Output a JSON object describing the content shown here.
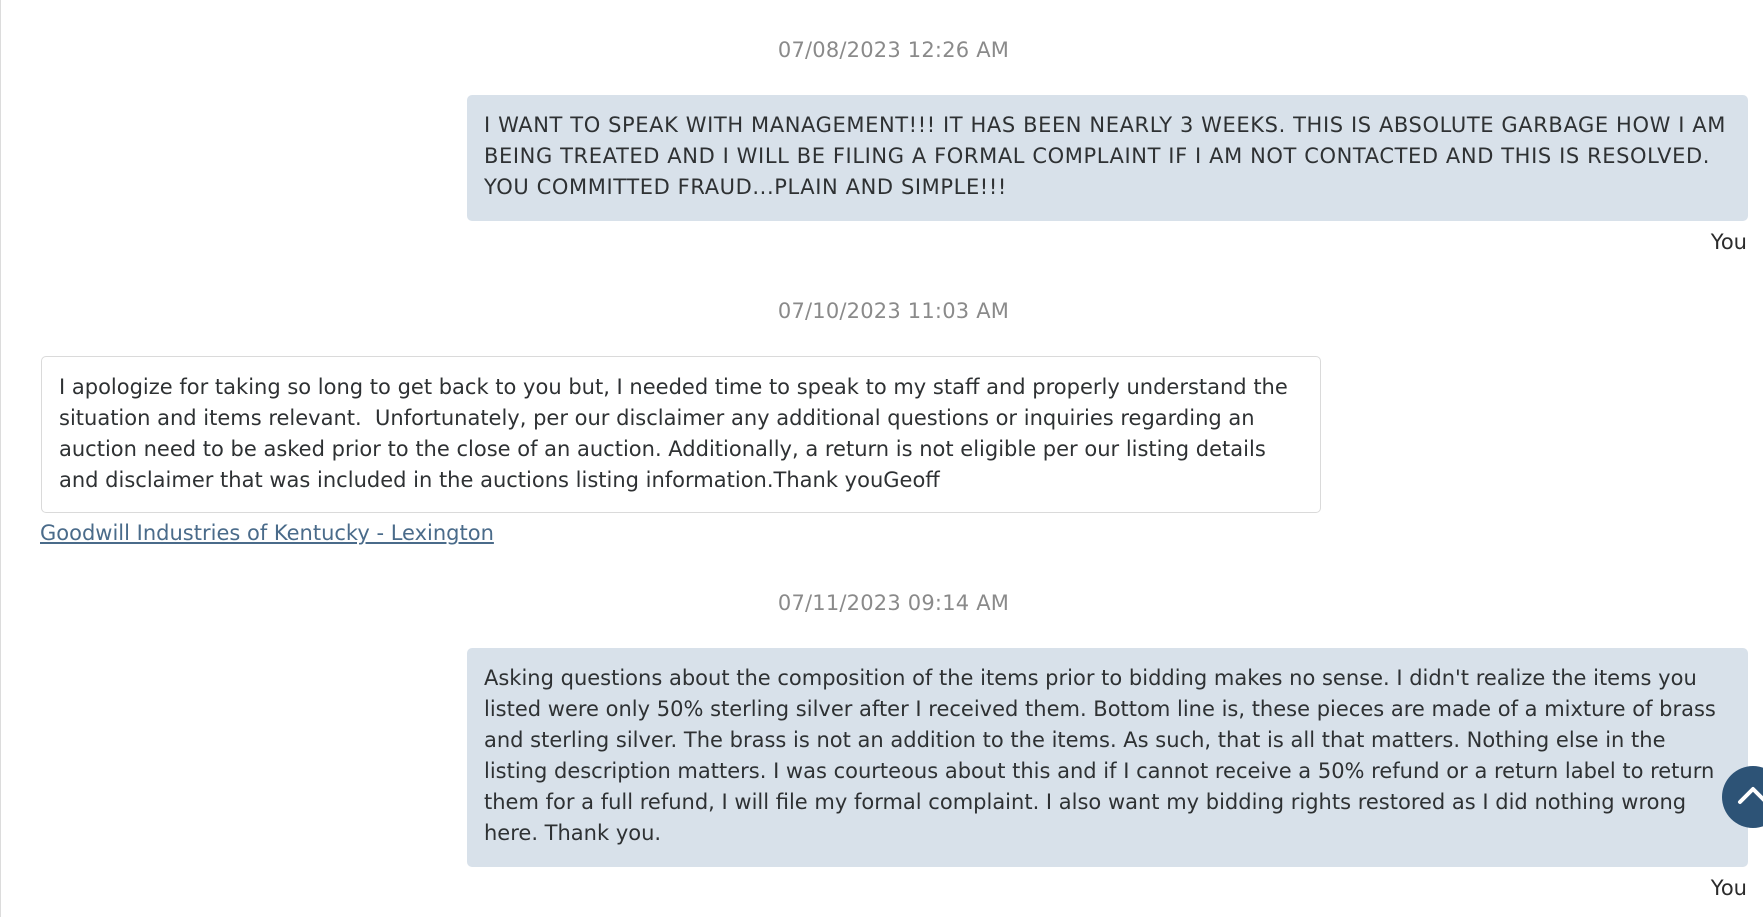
{
  "conversation": {
    "messages": [
      {
        "timestamp": "07/08/2023 12:26 AM",
        "text": "I WANT TO SPEAK WITH MANAGEMENT!!! IT HAS BEEN NEARLY 3 WEEKS. THIS IS ABSOLUTE GARBAGE HOW I AM BEING TREATED AND I WILL BE FILING A FORMAL COMPLAINT IF I AM NOT CONTACTED AND THIS IS RESOLVED. YOU COMMITTED FRAUD...PLAIN AND SIMPLE!!!",
        "sender": "You",
        "direction": "outgoing"
      },
      {
        "timestamp": "07/10/2023 11:03 AM",
        "text": "I apologize for taking so long to get back to you but, I needed time to speak to my staff and properly understand the situation and items relevant.  Unfortunately, per our disclaimer any additional questions or inquiries regarding an auction need to be asked prior to the close of an auction. Additionally, a return is not eligible per our listing details and disclaimer that was included in the auctions listing information.Thank youGeoff",
        "sender": "Goodwill Industries of Kentucky - Lexington",
        "direction": "incoming"
      },
      {
        "timestamp": "07/11/2023 09:14 AM",
        "text": "Asking questions about the composition of the items prior to bidding makes no sense. I didn't realize the items you listed were only 50% sterling silver after I received them. Bottom line is, these pieces are made of a mixture of brass and sterling silver. The brass is not an addition to the items. As such, that is all that matters. Nothing else in the listing description matters. I was courteous about this and if I cannot receive a 50% refund or a return label to return them for a full refund, I will file my formal complaint. I also want my bidding rights restored as I did nothing wrong here. Thank you.",
        "sender": "You",
        "direction": "outgoing"
      }
    ]
  },
  "scroll_top_button": {
    "icon": "chevron-up-icon"
  },
  "colors": {
    "outgoing_bubble": "#d8e1ea",
    "incoming_border": "#dadada",
    "timestamp": "#8a8a8a",
    "link": "#4a6b8a",
    "scroll_button": "#2d5376"
  }
}
